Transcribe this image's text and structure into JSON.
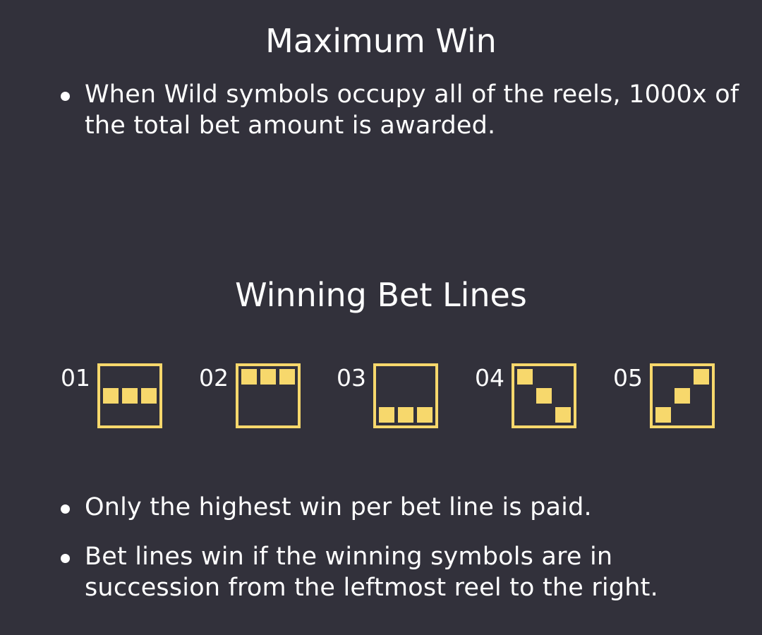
{
  "colors": {
    "background": "#32313b",
    "text": "#ffffff",
    "accent": "#f7d86c",
    "bullet": "#ffffff"
  },
  "max_win": {
    "title": "Maximum Win",
    "bullets": [
      "When Wild symbols occupy all of the reels, 1000x of the total bet amount is awarded."
    ]
  },
  "bet_lines": {
    "title": "Winning Bet Lines",
    "grid": {
      "rows": 3,
      "cols": 3
    },
    "lines": [
      {
        "number": "01",
        "rows_per_reel": [
          1,
          1,
          1
        ]
      },
      {
        "number": "02",
        "rows_per_reel": [
          0,
          0,
          0
        ]
      },
      {
        "number": "03",
        "rows_per_reel": [
          2,
          2,
          2
        ]
      },
      {
        "number": "04",
        "rows_per_reel": [
          0,
          1,
          2
        ]
      },
      {
        "number": "05",
        "rows_per_reel": [
          2,
          1,
          0
        ]
      }
    ],
    "bullets": [
      "Only the highest win per bet line is paid.",
      "Bet lines win if the winning symbols are in succession from the leftmost reel to the right."
    ]
  }
}
